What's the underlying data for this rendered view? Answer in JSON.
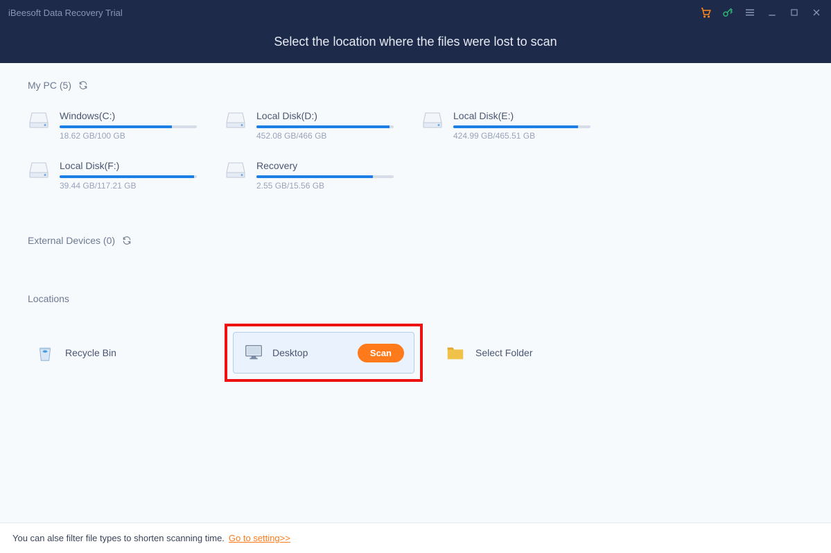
{
  "header": {
    "app_title": "iBeesoft Data Recovery Trial",
    "subtitle": "Select the location where the files were lost to scan"
  },
  "sections": {
    "my_pc_label": "My PC (5)",
    "external_label": "External Devices (0)",
    "locations_label": "Locations"
  },
  "drives": [
    {
      "name": "Windows(C:)",
      "usage": "18.62 GB/100 GB",
      "pct": 82
    },
    {
      "name": "Local Disk(D:)",
      "usage": "452.08 GB/466 GB",
      "pct": 97
    },
    {
      "name": "Local Disk(E:)",
      "usage": "424.99 GB/465.51 GB",
      "pct": 91
    },
    {
      "name": "Local Disk(F:)",
      "usage": "39.44 GB/117.21 GB",
      "pct": 98
    },
    {
      "name": "Recovery",
      "usage": "2.55 GB/15.56 GB",
      "pct": 85
    }
  ],
  "locations": {
    "recycle": "Recycle Bin",
    "desktop": "Desktop",
    "scan": "Scan",
    "select_folder": "Select Folder"
  },
  "footer": {
    "text": "You can alse filter file types to shorten scanning time.",
    "link": "Go to setting>>"
  }
}
